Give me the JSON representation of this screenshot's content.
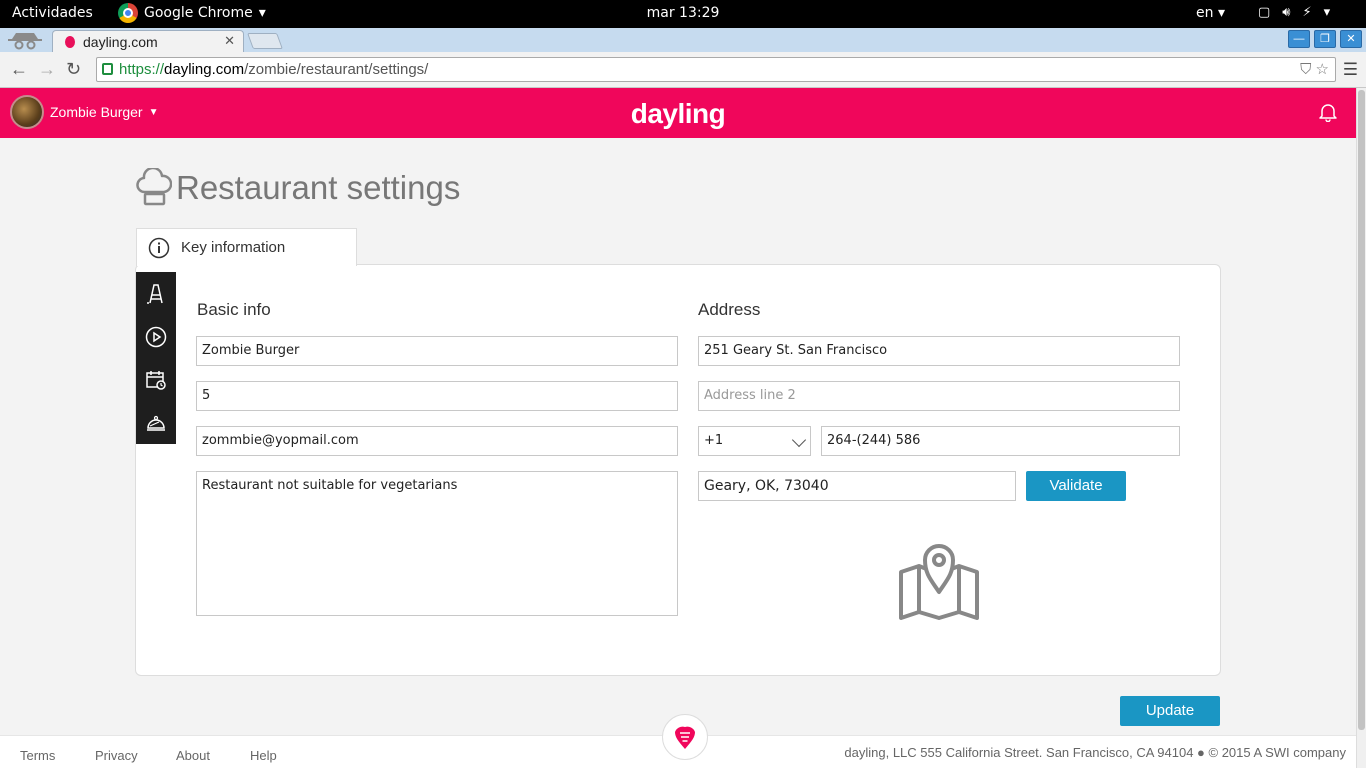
{
  "system_bar": {
    "activities": "Actividades",
    "app_name": "Google Chrome",
    "clock": "mar 13:29",
    "language": "en"
  },
  "browser": {
    "tab_title": "dayling.com",
    "url_scheme": "https://",
    "url_host": "dayling.com",
    "url_path": "/zombie/restaurant/settings/"
  },
  "header": {
    "user_name": "Zombie Burger",
    "logo": "dayling"
  },
  "page": {
    "title": "Restaurant settings",
    "active_tab": "Key information"
  },
  "basic_info": {
    "title": "Basic info",
    "name": "Zombie Burger",
    "number": "5",
    "email": "zommbie@yopmail.com",
    "description": "Restaurant not suitable for vegetarians"
  },
  "address": {
    "title": "Address",
    "line1": "251 Geary St. San Francisco",
    "line2_placeholder": "Address line 2",
    "country_code": "+1",
    "phone": "264-(244) 586",
    "city_state_zip": "Geary,  OK,  73040",
    "validate_label": "Validate"
  },
  "actions": {
    "update_label": "Update"
  },
  "footer": {
    "terms": "Terms",
    "privacy": "Privacy",
    "about": "About",
    "help": "Help",
    "copyright": "dayling, LLC 555 California Street. San Francisco, CA 94104 ● © 2015 A SWI company"
  },
  "colors": {
    "brand": "#f0065b",
    "button": "#1a96c4",
    "sidebar": "#1e1e1e"
  }
}
